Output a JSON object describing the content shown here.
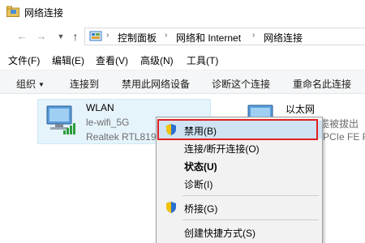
{
  "window": {
    "title": "网络连接"
  },
  "address": {
    "crumbs": [
      "控制面板",
      "网络和 Internet",
      "网络连接"
    ]
  },
  "menubar": {
    "items": [
      "文件(F)",
      "编辑(E)",
      "查看(V)",
      "高级(N)",
      "工具(T)"
    ]
  },
  "commandbar": {
    "items": [
      "组织",
      "连接到",
      "禁用此网络设备",
      "诊断这个连接",
      "重命名此连接"
    ]
  },
  "connections": [
    {
      "name": "WLAN",
      "ssid": "le-wifi_5G",
      "adapter": "Realtek RTL819"
    },
    {
      "name": "以太网",
      "status": "缆被拔出",
      "adapter": "PCIe FE F"
    }
  ],
  "context_menu": {
    "items": [
      {
        "label": "禁用(B)",
        "bold": false,
        "icon": "shield-icon",
        "highlighted": true
      },
      {
        "label": "连接/断开连接(O)",
        "bold": false,
        "icon": null
      },
      {
        "label": "状态(U)",
        "bold": true,
        "icon": null
      },
      {
        "label": "诊断(I)",
        "bold": false,
        "icon": null
      },
      {
        "label": "桥接(G)",
        "bold": false,
        "icon": "shield-icon"
      },
      {
        "label": "创建快捷方式(S)",
        "bold": false,
        "icon": null
      }
    ]
  },
  "colors": {
    "selection_bg": "#e5f3fb",
    "highlight_bg": "#cfe3f3",
    "annotation_red": "#e02020"
  }
}
